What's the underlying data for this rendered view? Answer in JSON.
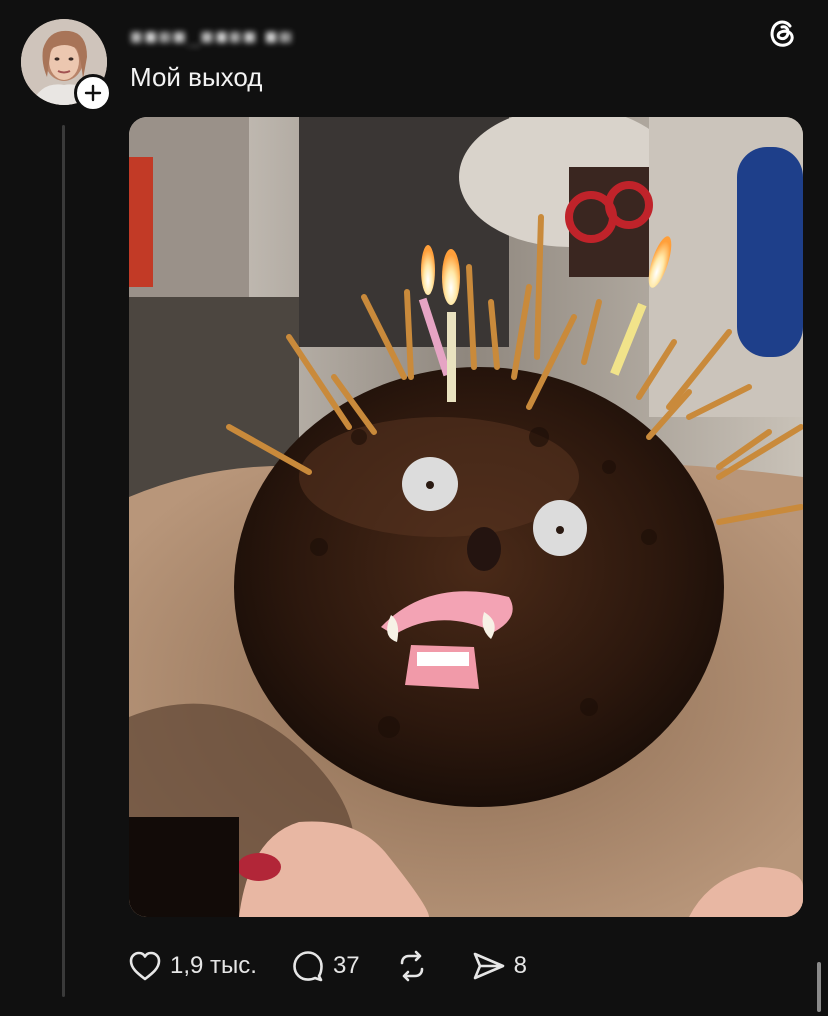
{
  "post": {
    "username": "■■■■_■■■■ ■■",
    "text": "Мой выход",
    "image_description_icon": "photo"
  },
  "actions": {
    "like_count": "1,9 тыс.",
    "comment_count": "37",
    "repost_count": "",
    "share_count": "8"
  },
  "icons": {
    "like": "heart-icon",
    "comment": "speech-bubble-icon",
    "repost": "repost-icon",
    "share": "send-icon",
    "app": "threads-logo-icon",
    "follow": "plus-icon"
  },
  "colors": {
    "background": "#101010",
    "text": "#f3f3f3",
    "thread_line": "#3a3a3a"
  }
}
